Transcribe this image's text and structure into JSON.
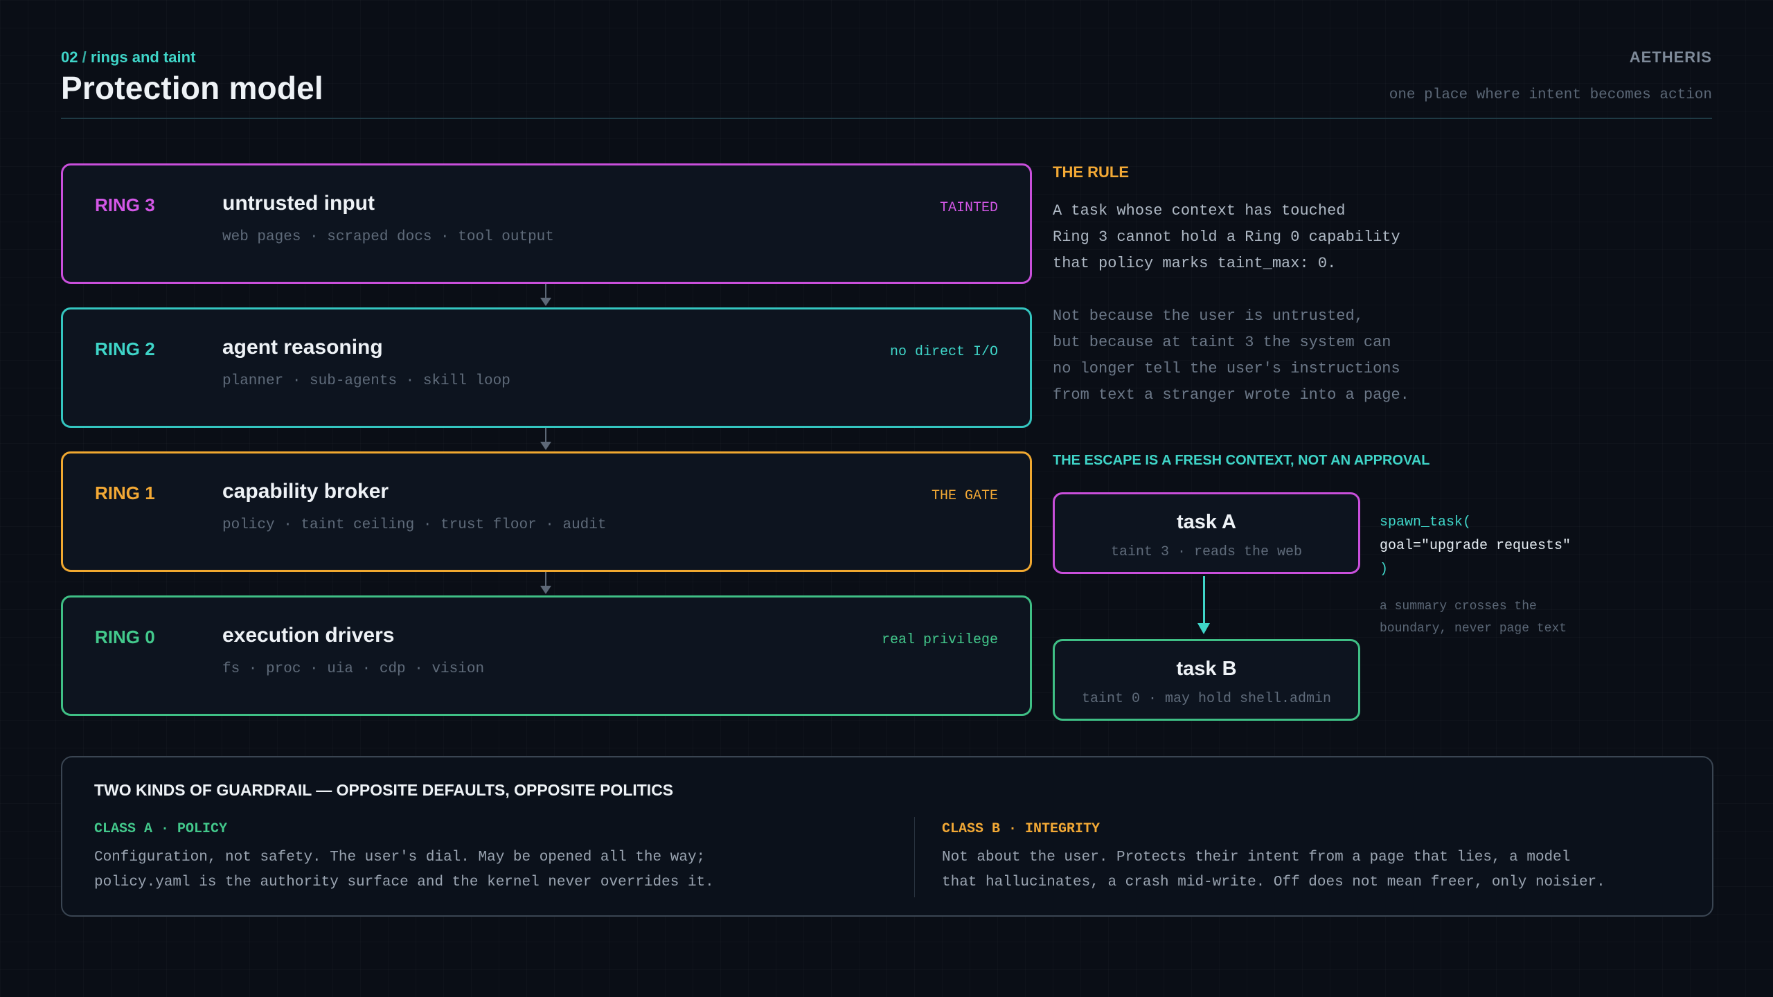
{
  "header": {
    "kicker_num": "02",
    "kicker_sep": "/",
    "kicker_text": "rings and taint",
    "title": "Protection model",
    "brand": "AETHERIS",
    "tagline": "one place where intent becomes action"
  },
  "rings": [
    {
      "label": "RING 3",
      "title": "untrusted input",
      "subtitle": "web pages · scraped docs · tool output",
      "tag": "TAINTED"
    },
    {
      "label": "RING 2",
      "title": "agent reasoning",
      "subtitle": "planner · sub-agents · skill loop",
      "tag": "no direct I/O"
    },
    {
      "label": "RING 1",
      "title": "capability broker",
      "subtitle": "policy · taint ceiling · trust floor · audit",
      "tag": "THE GATE"
    },
    {
      "label": "RING 0",
      "title": "execution drivers",
      "subtitle": "fs · proc · uia · cdp · vision",
      "tag": "real privilege"
    }
  ],
  "rule": {
    "heading": "THE RULE",
    "paragraph1": [
      "A task whose context has touched",
      "Ring 3 cannot hold a Ring 0 capability",
      "that policy marks taint_max: 0."
    ],
    "paragraph2": [
      "Not because the user is untrusted,",
      "but because at taint 3 the system can",
      "no longer tell the user's instructions",
      "from text a stranger wrote into a page."
    ]
  },
  "escape": {
    "heading": "THE ESCAPE IS A FRESH CONTEXT, NOT AN APPROVAL",
    "task_a": {
      "title": "task A",
      "subtitle": "taint 3 · reads the web"
    },
    "task_b": {
      "title": "task B",
      "subtitle": "taint 0 · may hold shell.admin"
    },
    "code": {
      "call": "spawn_task(",
      "arg": "goal=\"upgrade requests\"",
      "close": ")"
    },
    "note": [
      "a summary crosses the",
      "boundary, never page text"
    ]
  },
  "guardrails": {
    "heading": "TWO KINDS OF GUARDRAIL — OPPOSITE DEFAULTS, OPPOSITE POLITICS",
    "class_a": {
      "label": "CLASS A · POLICY",
      "body": [
        "Configuration, not safety. The user's dial. May be opened all the way;",
        "policy.yaml is the authority surface and the kernel never overrides it."
      ]
    },
    "class_b": {
      "label": "CLASS B · INTEGRITY",
      "body": [
        "Not about the user. Protects their intent from a page that lies, a model",
        "that hallucinates, a crash mid-write. Off does not mean freer, only noisier."
      ]
    }
  },
  "colors": {
    "background": "#0a0e16",
    "ring3": "#c94fdb",
    "ring2": "#34c6c0",
    "ring1": "#f0a830",
    "ring0": "#3fbf85",
    "accent_teal": "#3fd5c8",
    "accent_amber": "#f3a935"
  }
}
